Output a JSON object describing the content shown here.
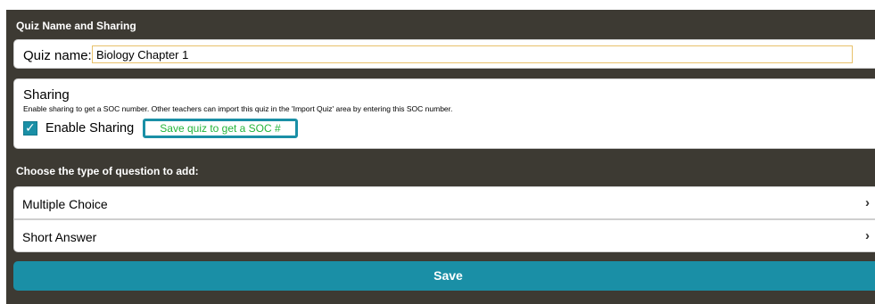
{
  "quiz_section": {
    "title": "Quiz Name and Sharing",
    "name_label": "Quiz name:",
    "name_value": "Biology Chapter 1"
  },
  "sharing": {
    "title": "Sharing",
    "description": "Enable sharing to get a SOC number. Other teachers can import this quiz in the 'Import Quiz' area by entering this SOC number.",
    "checkbox_label": "Enable Sharing",
    "checked": true,
    "soc_button_label": "Save quiz to get a SOC #"
  },
  "question_types": {
    "title": "Choose the type of question to add:",
    "items": [
      {
        "label": "Multiple Choice",
        "chevron": "›"
      },
      {
        "label": "Short Answer",
        "chevron": "›"
      }
    ]
  },
  "save_label": "Save",
  "colors": {
    "panel_bg": "#3d3a33",
    "accent": "#1a8fa6",
    "soc_text": "#23b43a"
  }
}
